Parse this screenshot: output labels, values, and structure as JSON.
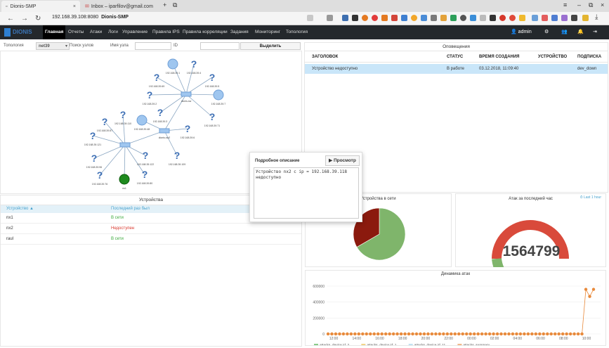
{
  "browser": {
    "tabs": [
      {
        "title": "Dionis-SMP"
      },
      {
        "title": "Inbox – iparfilov@gmail.com"
      }
    ],
    "url": "192.168.39.108:8080",
    "page_title": "Dionis-SMP"
  },
  "app": {
    "logo": "DIONIS",
    "nav": [
      "Главная",
      "Отчеты",
      "Атаки",
      "Логи",
      "Управление",
      "Правила IPS",
      "Правила корреляции",
      "Задания",
      "Мониторинг",
      "Топология"
    ],
    "user": "admin"
  },
  "toolbar": {
    "topology_label": "Топология",
    "net_value": "net39",
    "search_label": "Поиск узлов",
    "node_name_label": "Имя узла",
    "id_label": "ID",
    "highlight_button": "Выделить"
  },
  "topology": {
    "nodes": [
      "192.168.39.1",
      "192.168.39.4",
      "192.168.39.69",
      "192.168.39.5",
      "192.168.39.7",
      "192.168.39.2",
      "192.168.39.3",
      "192.168.39.71",
      "192.168.39.6",
      "192.168.39.110",
      "192.168.39.87",
      "192.168.39.121",
      "192.168.39.48",
      "192.168.39.96",
      "192.168.39.122",
      "192.168.39.76",
      "192.168.39.80",
      "192.168.39.109"
    ],
    "switches": [
      "dionis-sw",
      "dionis-sw2"
    ],
    "root_label": "ns1"
  },
  "devices": {
    "title": "Устройства",
    "col_device": "Устройство ▲",
    "col_last_seen": "Последний раз был",
    "rows": [
      {
        "name": "nx1",
        "status": "В сети",
        "color": "#3aa83a"
      },
      {
        "name": "nx2",
        "status": "Недоступен",
        "color": "#d9362b"
      },
      {
        "name": "raul",
        "status": "В сети",
        "color": "#3aa83a"
      }
    ]
  },
  "alerts": {
    "title": "Оповещения",
    "headers": [
      "ЗАГОЛОВОК",
      "СТАТУС",
      "ВРЕМЯ СОЗДАНИЯ",
      "УСТРОЙСТВО",
      "ПОДПИСКА"
    ],
    "rows": [
      {
        "title": "Устройство недоступно",
        "status": "В работе",
        "created": "03.12.2018, 11:09:40",
        "device": "",
        "subscription": "dev_down"
      }
    ]
  },
  "popup": {
    "title": "Подробное описание",
    "view_button": "Просмотр",
    "body": "Устройство nx2 с ip = 192.168.39.118 недоступно"
  },
  "widgets": {
    "devices_online_title": "Устройства в сети",
    "attacks_hour_title": "Атак за последний час",
    "last_hour_link": "⏱ Last 1 hour",
    "attacks_count": "1564799",
    "dynamics_title": "Динамика атак"
  },
  "chart_data": [
    {
      "type": "pie",
      "title": "Устройства в сети",
      "values": [
        2,
        1
      ],
      "colors": [
        "#7fb56b",
        "#8b1a0e"
      ]
    },
    {
      "type": "line",
      "title": "Динамика атак",
      "x": [
        "12:00",
        "14:00",
        "16:00",
        "18:00",
        "20:00",
        "22:00",
        "00:00",
        "02:00",
        "04:00",
        "06:00",
        "08:00",
        "10:00"
      ],
      "ylim": [
        0,
        600000
      ],
      "yticks": [
        "600000",
        "400000",
        "200000",
        "0"
      ],
      "series": [
        {
          "name": "attacks, device id: 2",
          "color": "#3aa83a"
        },
        {
          "name": "attacks, device id: 1",
          "color": "#e8b63a"
        },
        {
          "name": "attacks, device id: 11",
          "color": "#9ad0ea"
        },
        {
          "name": "attacks, summary",
          "color": "#e8893a"
        }
      ]
    }
  ]
}
